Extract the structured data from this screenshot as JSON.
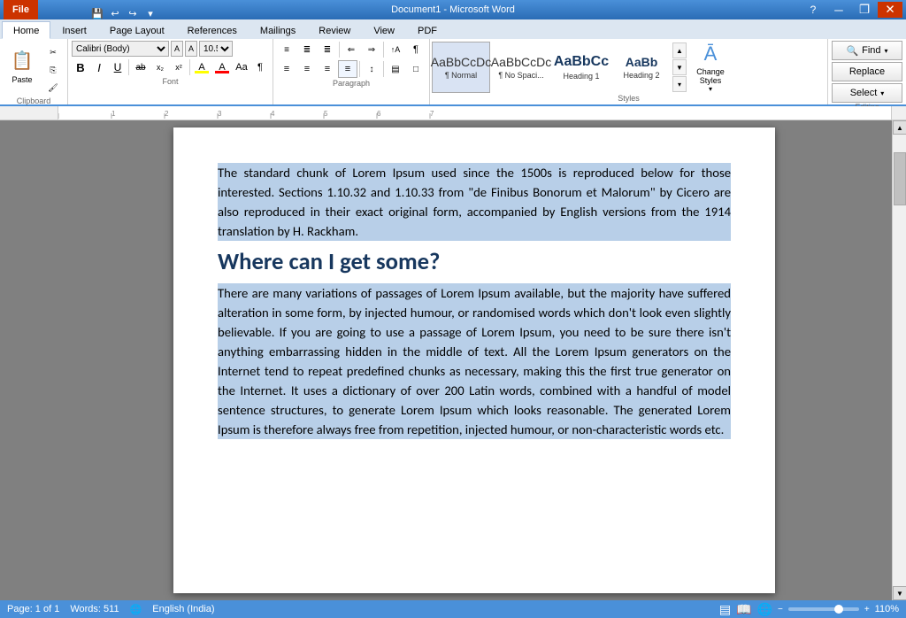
{
  "titlebar": {
    "file_btn": "File",
    "doc_title": "Document1 - Microsoft Word",
    "tabs": [
      "Home",
      "Insert",
      "Page Layout",
      "References",
      "Mailings",
      "Review",
      "View",
      "PDF"
    ],
    "active_tab": "Home",
    "win_minimize": "─",
    "win_restore": "❐",
    "win_close": "✕",
    "help_icon": "?"
  },
  "qat": {
    "save": "💾",
    "undo": "↩",
    "redo": "↪",
    "customize": "▾"
  },
  "ribbon": {
    "clipboard": {
      "label": "Clipboard",
      "paste_label": "Paste",
      "cut_label": "Cut",
      "copy_label": "Copy",
      "format_painter_label": "Format Painter"
    },
    "font": {
      "label": "Font",
      "font_name": "Calibri (Body)",
      "font_size": "10.5",
      "bold": "B",
      "italic": "I",
      "underline": "U",
      "strikethrough": "ab",
      "subscript": "x₂",
      "superscript": "x²",
      "text_color": "A",
      "highlight": "A",
      "grow": "A",
      "shrink": "A",
      "change_case": "Aa",
      "clear_format": "¶"
    },
    "paragraph": {
      "label": "Paragraph",
      "bullets": "≡",
      "numbering": "≣",
      "multilevel": "≣",
      "decrease_indent": "⇐",
      "increase_indent": "⇒",
      "sort": "↑A",
      "show_hide": "¶",
      "align_left": "≡",
      "center": "≡",
      "align_right": "≡",
      "justify": "≡",
      "line_spacing": "↕",
      "shading": "▤",
      "borders": "□"
    },
    "styles": {
      "label": "Styles",
      "normal_label": "¶ Normal",
      "nospace_label": "¶ No Spaci...",
      "heading1_label": "Heading 1",
      "heading2_label": "Heading 2",
      "change_styles_label": "Change\nStyles",
      "select_label": "Select"
    },
    "editing": {
      "label": "Editing",
      "find_label": "Find",
      "replace_label": "Replace",
      "select_label": "Select"
    }
  },
  "ruler": {
    "marks": [
      "1",
      "2",
      "3",
      "4",
      "5",
      "6"
    ]
  },
  "document": {
    "para1": "The standard chunk of Lorem Ipsum used since the 1500s is reproduced below for those interested. Sections 1.10.32 and 1.10.33 from \"de Finibus Bonorum et Malorum\" by Cicero are also reproduced in their exact original form, accompanied by English versions from the 1914 translation by H. Rackham.",
    "heading": "Where can I get some?",
    "para2": "There are many variations of passages of Lorem Ipsum available, but the majority have suffered alteration in some form, by injected humour, or randomised words which don't look even slightly believable. If you are going to use a passage of Lorem Ipsum, you need to be sure there isn't anything embarrassing hidden in the middle of text. All the Lorem Ipsum generators on the Internet tend to repeat predefined chunks as necessary, making this the first true generator on the Internet. It uses a dictionary of over 200 Latin words, combined with a handful of model sentence structures, to generate Lorem Ipsum which looks reasonable. The generated Lorem Ipsum is therefore always free from repetition, injected humour, or non-characteristic words etc."
  },
  "statusbar": {
    "page_info": "Page: 1 of 1",
    "words": "Words: 511",
    "lang_icon": "🌐",
    "language": "English (India)",
    "zoom_percent": "110%",
    "zoom_minus": "−",
    "zoom_plus": "+"
  }
}
